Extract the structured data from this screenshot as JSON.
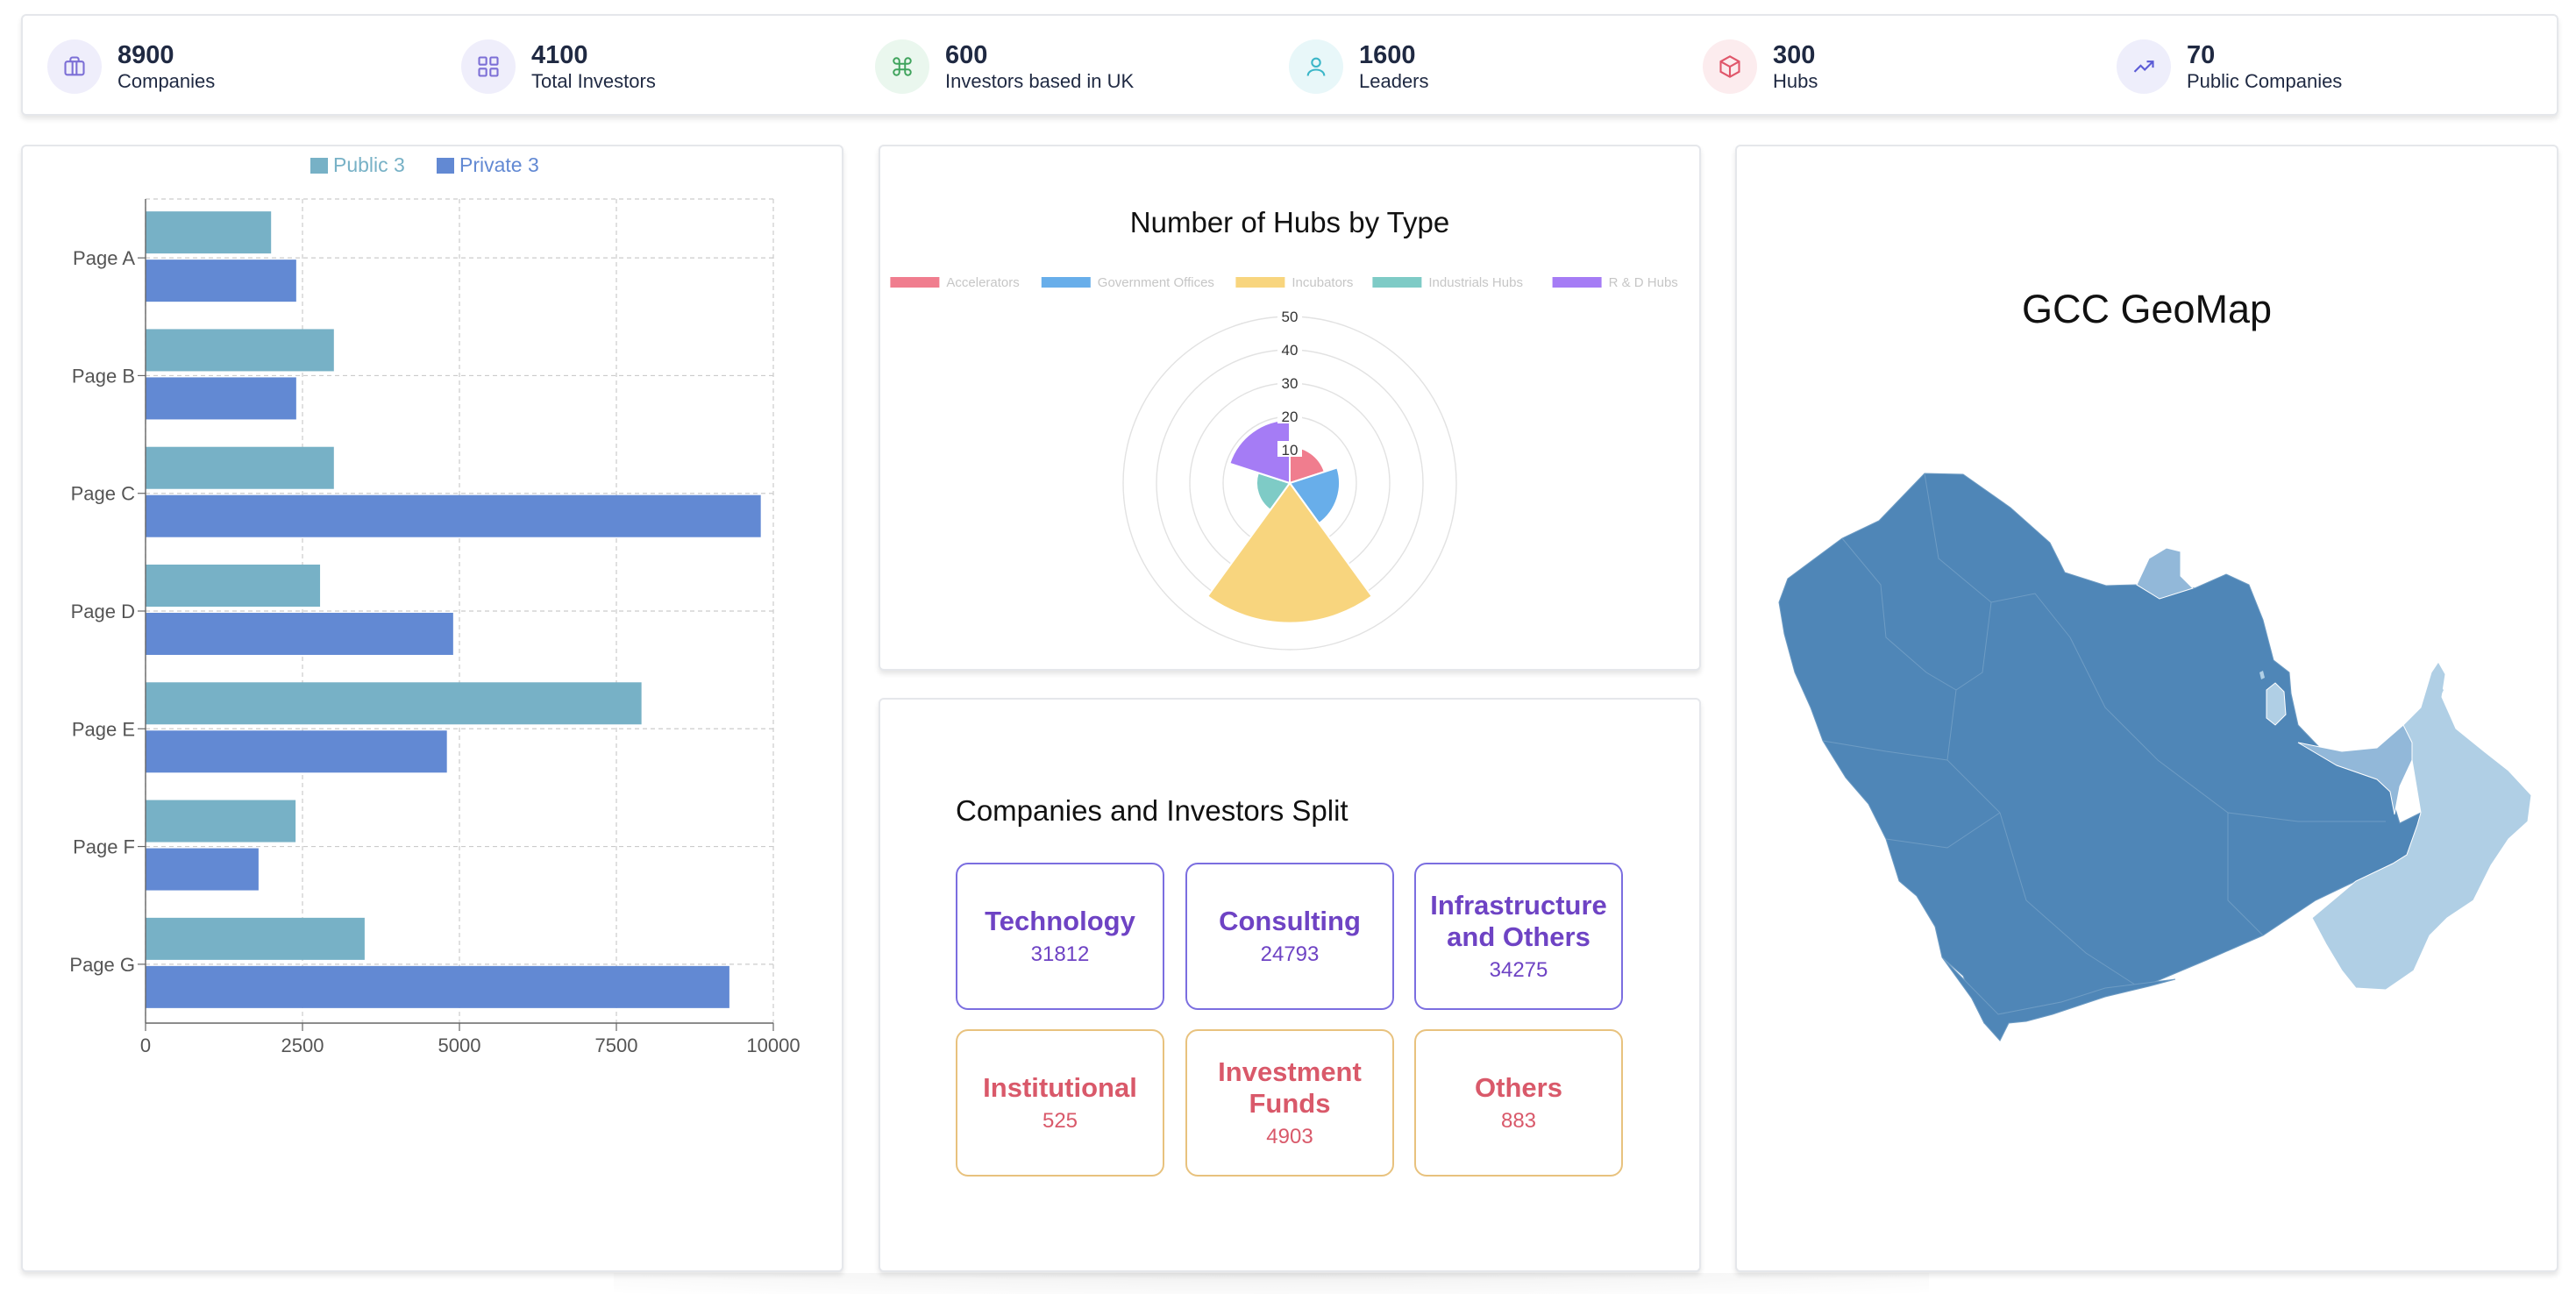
{
  "stats": [
    {
      "value": "8900",
      "label": "Companies",
      "icon": "briefcase-icon",
      "color": "#7c6fd6",
      "bg": "#efeefb"
    },
    {
      "value": "4100",
      "label": "Total Investors",
      "icon": "grid-icon",
      "color": "#7c6fd6",
      "bg": "#efeefb"
    },
    {
      "value": "600",
      "label": "Investors based in UK",
      "icon": "command-icon",
      "color": "#3fa35c",
      "bg": "#eaf7ee"
    },
    {
      "value": "1600",
      "label": "Leaders",
      "icon": "user-icon",
      "color": "#3bb6c8",
      "bg": "#e8f7f9"
    },
    {
      "value": "300",
      "label": "Hubs",
      "icon": "box-icon",
      "color": "#e0566a",
      "bg": "#fcecee"
    },
    {
      "value": "70",
      "label": "Public Companies",
      "icon": "trending-up-icon",
      "color": "#5b5bd6",
      "bg": "#eeeefb"
    }
  ],
  "bar_chart": {
    "chart_data": {
      "type": "bar",
      "orientation": "horizontal",
      "categories": [
        "Page A",
        "Page B",
        "Page C",
        "Page D",
        "Page E",
        "Page F",
        "Page G"
      ],
      "series": [
        {
          "name": "Public 3",
          "color": "#77b1c6",
          "values": [
            2000,
            3000,
            3000,
            2780,
            7900,
            2390,
            3490
          ]
        },
        {
          "name": "Private 3",
          "color": "#6289d3",
          "values": [
            2400,
            2400,
            9800,
            4900,
            4800,
            1800,
            9300
          ]
        }
      ],
      "xlim": [
        0,
        10000
      ],
      "xticks": [
        "0",
        "2500",
        "5000",
        "7500",
        "10000"
      ],
      "grid": true,
      "legend": "top"
    }
  },
  "polar_chart": {
    "chart_data": {
      "type": "polarArea",
      "title": "Number of Hubs by Type",
      "categories": [
        "Accelerators",
        "Government Offices",
        "Incubators",
        "Industrials Hubs",
        "R & D Hubs"
      ],
      "values": [
        11,
        15,
        42,
        10,
        19
      ],
      "colors": [
        "#f07d8e",
        "#68aeea",
        "#f8d57e",
        "#7ecbc6",
        "#a57cf5"
      ],
      "rlim": [
        0,
        50
      ],
      "rticks": [
        "10",
        "20",
        "30",
        "40",
        "50"
      ],
      "legend": "top"
    }
  },
  "split": {
    "title": "Companies and Investors Split",
    "tiles": [
      {
        "name": "Technology",
        "value": "31812",
        "row": "top"
      },
      {
        "name": "Consulting",
        "value": "24793",
        "row": "top"
      },
      {
        "name": "Infrastructure and Others",
        "value": "34275",
        "row": "top"
      },
      {
        "name": "Institutional",
        "value": "525",
        "row": "bot"
      },
      {
        "name": "Investment Funds",
        "value": "4903",
        "row": "bot"
      },
      {
        "name": "Others",
        "value": "883",
        "row": "bot"
      }
    ]
  },
  "map": {
    "title": "GCC GeoMap",
    "colors": {
      "dark": "#4f86b7",
      "mid": "#92b8d9",
      "light": "#b0cfe5"
    }
  }
}
